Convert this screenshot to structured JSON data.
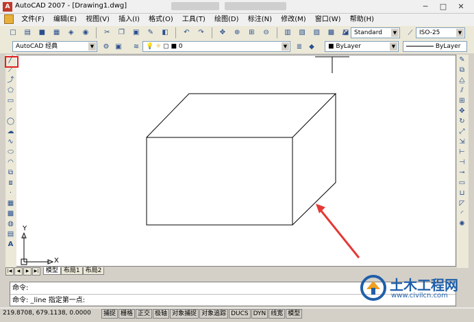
{
  "titlebar": {
    "title": "AutoCAD 2007 - [Drawing1.dwg]",
    "minimize": "─",
    "maximize": "□",
    "close": "✕"
  },
  "menubar": {
    "items": [
      "文件(F)",
      "编辑(E)",
      "视图(V)",
      "插入(I)",
      "格式(O)",
      "工具(T)",
      "绘图(D)",
      "标注(N)",
      "修改(M)",
      "窗口(W)",
      "帮助(H)"
    ]
  },
  "toolbar1": {
    "text_style": "Standard",
    "dim_style": "ISO-25"
  },
  "toolbar2": {
    "workspace": "AutoCAD 经典",
    "layer": "0",
    "color": "ByLayer",
    "linetype": "ByLayer"
  },
  "ucs": {
    "x_label": "X",
    "y_label": "Y"
  },
  "layout_tabs": [
    "模型",
    "布局1",
    "布局2"
  ],
  "command": {
    "line1": "命令:",
    "line2": "命令: _line 指定第一点:"
  },
  "status": {
    "coords": "219.8708, 679.1138, 0.0000",
    "buttons": [
      "捕捉",
      "栅格",
      "正交",
      "极轴",
      "对象捕捉",
      "对象追踪",
      "DUCS",
      "DYN",
      "线宽",
      "模型"
    ]
  },
  "watermark": {
    "cn": "土木工程网",
    "url": "www.civilcn.com"
  }
}
